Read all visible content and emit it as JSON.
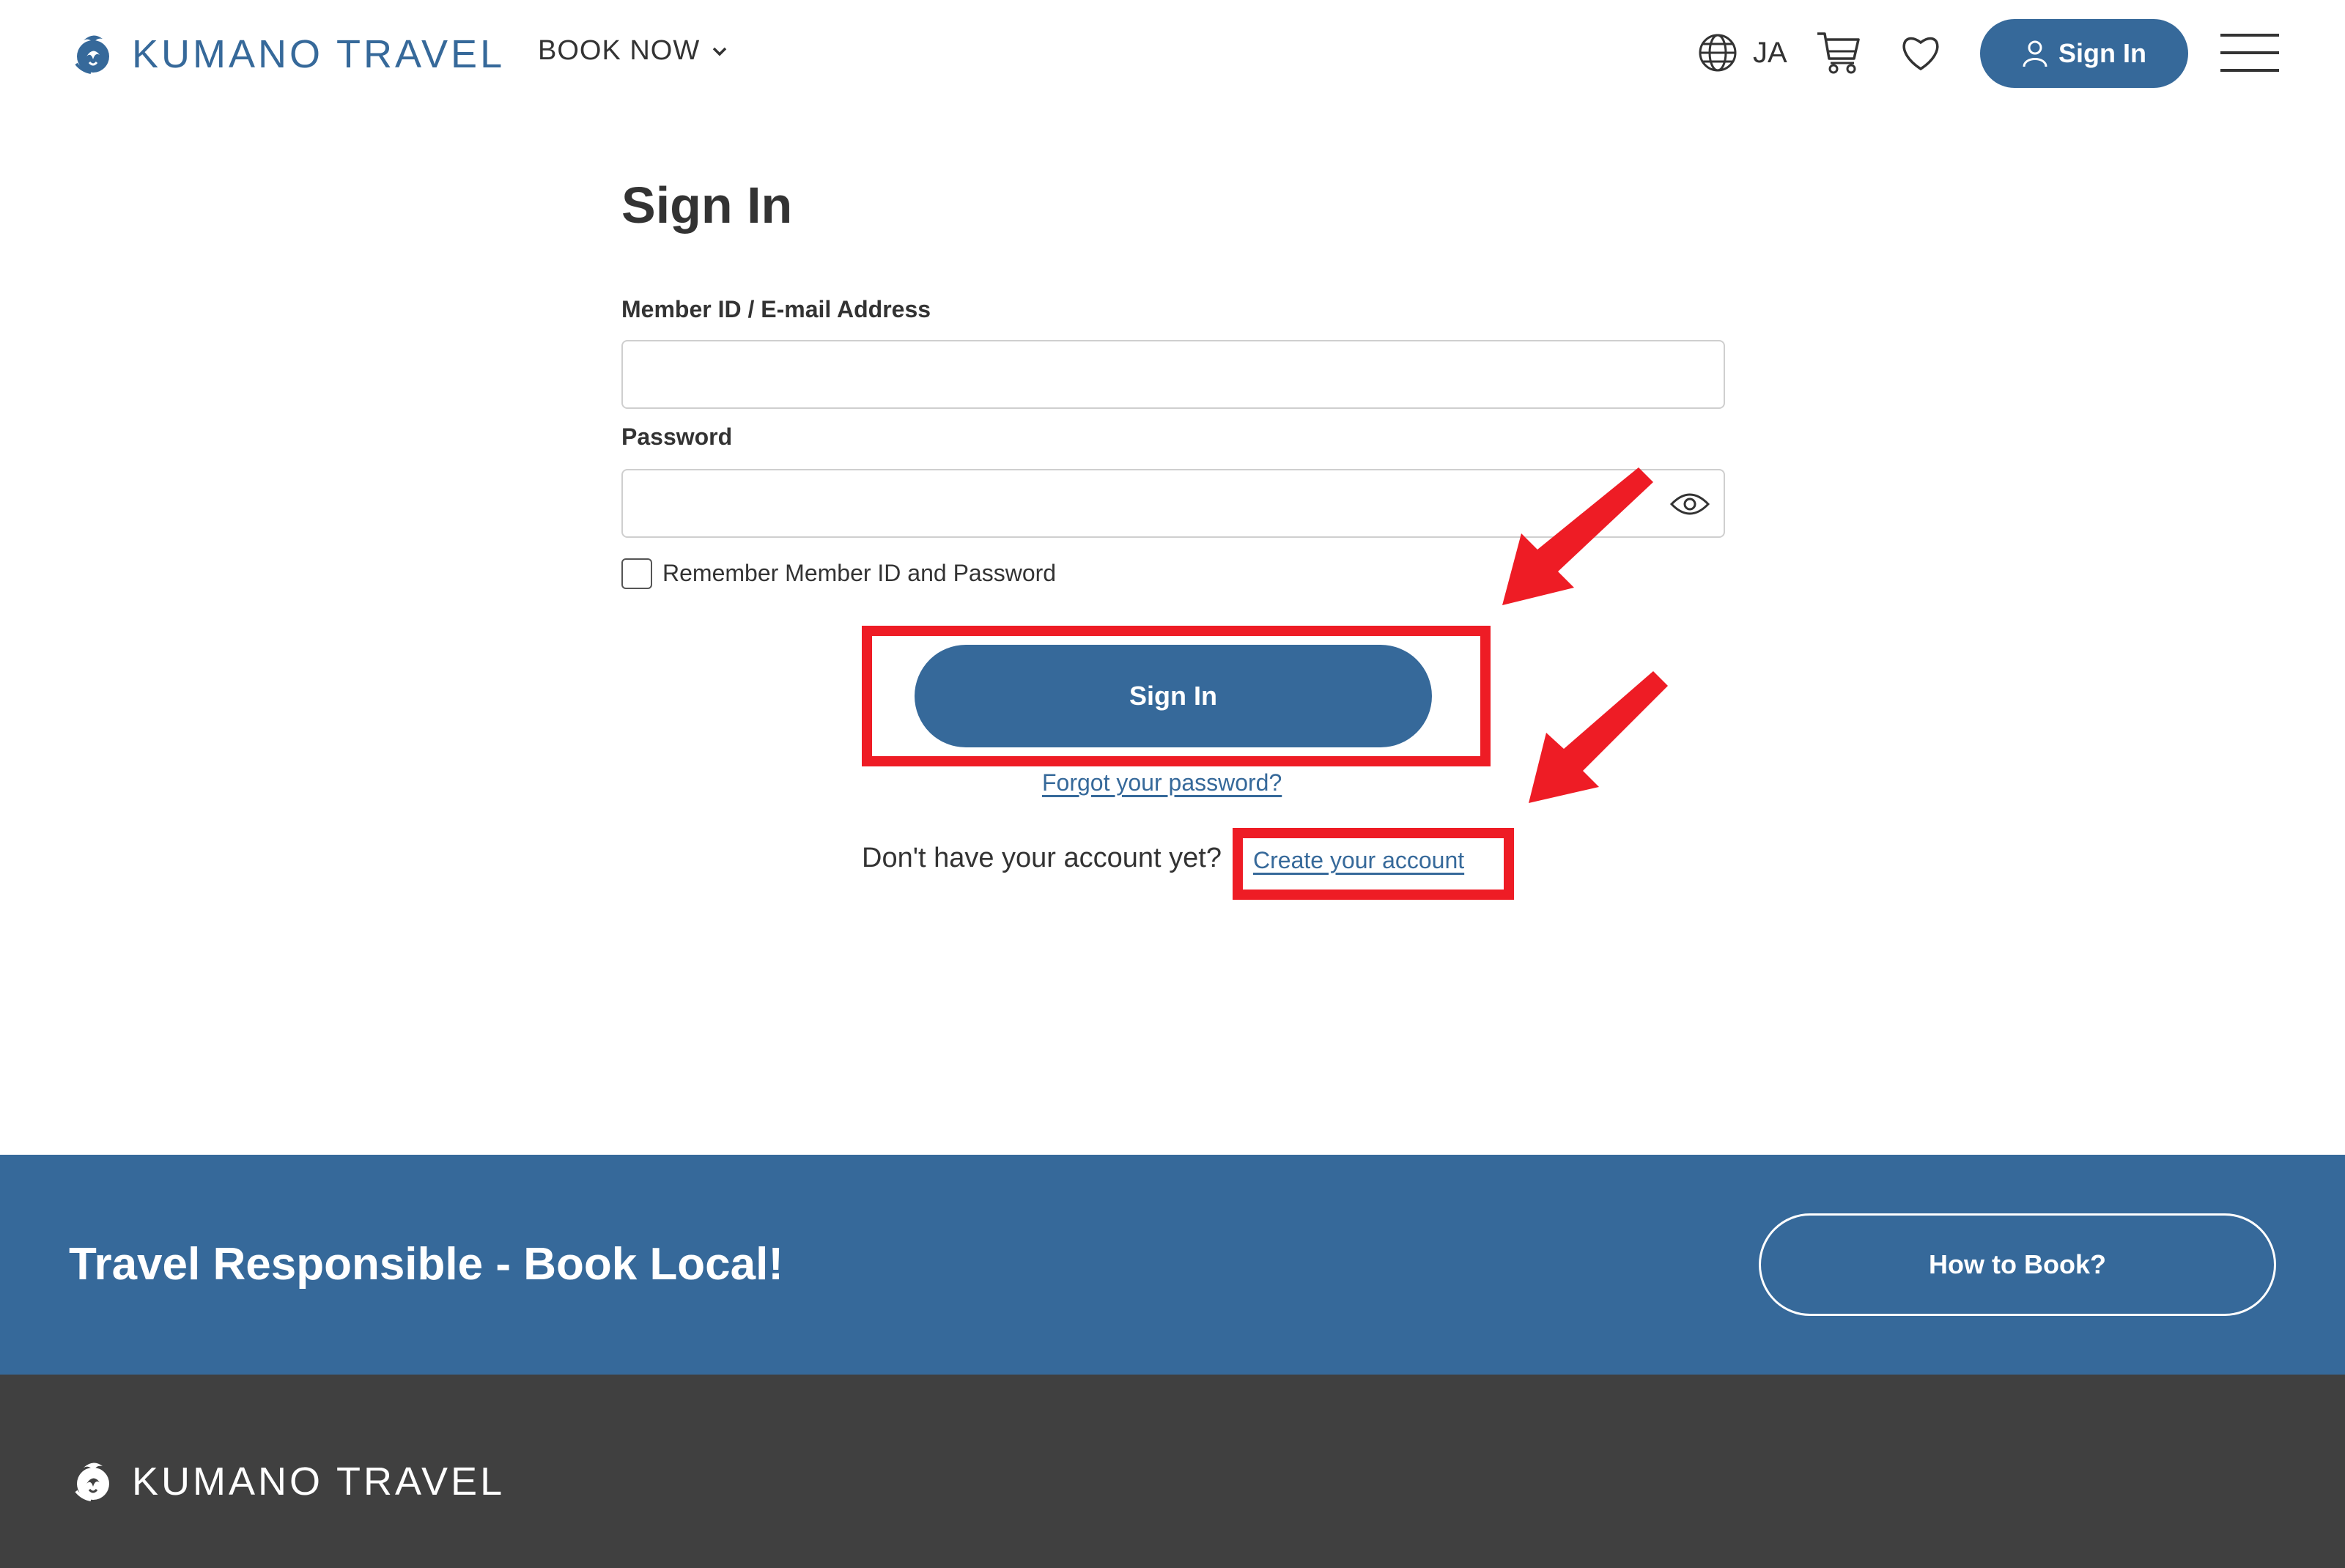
{
  "header": {
    "logo_text": "KUMANO TRAVEL",
    "book_now": "BOOK NOW",
    "language": "JA",
    "signin_label": "Sign In"
  },
  "form": {
    "title": "Sign In",
    "id_label": "Member ID / E-mail Address",
    "id_value": "",
    "password_label": "Password",
    "password_value": "",
    "remember_label": "Remember Member ID and Password",
    "remember_checked": false,
    "submit_label": "Sign In",
    "forgot_link": "Forgot your password?",
    "no_account_text": "Don't have your account yet?",
    "create_link": "Create your account"
  },
  "banner": {
    "text": "Travel Responsible - Book Local!",
    "button_label": "How to Book?"
  },
  "footer": {
    "logo_text": "KUMANO TRAVEL"
  },
  "colors": {
    "brand": "#36699a",
    "annotation": "#ee1c25",
    "footer": "#404040"
  },
  "icons": [
    "phoenix-logo-icon",
    "chevron-down-icon",
    "globe-icon",
    "cart-icon",
    "heart-icon",
    "user-icon",
    "hamburger-menu-icon",
    "eye-icon"
  ]
}
